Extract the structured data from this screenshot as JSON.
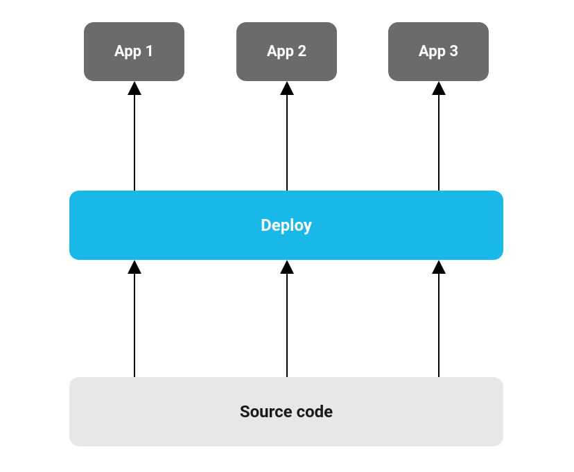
{
  "apps": [
    {
      "label": "App 1"
    },
    {
      "label": "App 2"
    },
    {
      "label": "App 3"
    }
  ],
  "deploy": {
    "label": "Deploy"
  },
  "source": {
    "label": "Source code"
  },
  "colors": {
    "appBox": "#6b6b6b",
    "deployBox": "#18b8e8",
    "sourceBox": "#e7e7e7",
    "arrow": "#000000",
    "appText": "#ffffff",
    "deployText": "#ffffff",
    "sourceText": "#1a1a1a"
  },
  "chart_data": {
    "type": "flow-diagram",
    "nodes": [
      {
        "id": "source",
        "label": "Source code",
        "layer": 0
      },
      {
        "id": "deploy",
        "label": "Deploy",
        "layer": 1
      },
      {
        "id": "app1",
        "label": "App 1",
        "layer": 2
      },
      {
        "id": "app2",
        "label": "App 2",
        "layer": 2
      },
      {
        "id": "app3",
        "label": "App 3",
        "layer": 2
      }
    ],
    "edges": [
      {
        "from": "source",
        "to": "deploy",
        "count": 3
      },
      {
        "from": "deploy",
        "to": "app1"
      },
      {
        "from": "deploy",
        "to": "app2"
      },
      {
        "from": "deploy",
        "to": "app3"
      }
    ]
  }
}
